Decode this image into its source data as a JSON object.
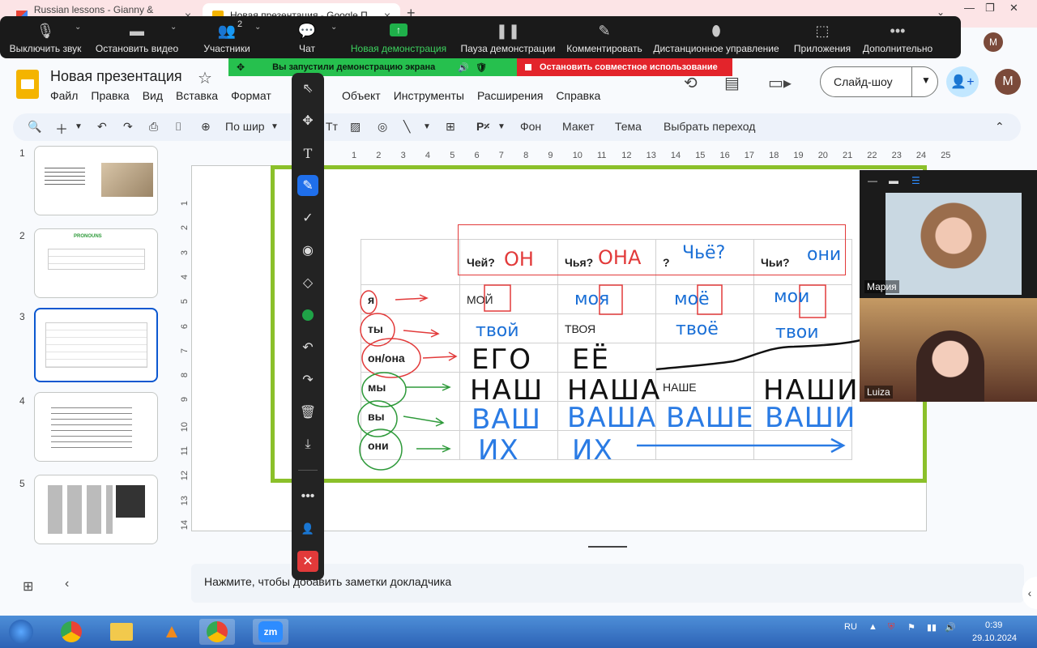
{
  "browser": {
    "tabs": [
      {
        "title": "Russian lessons - Gianny & Luiza",
        "favicon": "gmail-icon"
      },
      {
        "title": "Новая презентация - Google П",
        "favicon": "slides-icon"
      }
    ],
    "new_tab": "+",
    "profile_initial": "M"
  },
  "zoom": {
    "buttons": [
      {
        "label": "Выключить звук",
        "icon": "microphone-icon"
      },
      {
        "label": "Остановить видео",
        "icon": "camera-icon"
      },
      {
        "label": "Участники",
        "icon": "participants-icon",
        "count": "2"
      },
      {
        "label": "Чат",
        "icon": "chat-icon"
      },
      {
        "label": "Новая демонстрация",
        "icon": "share-screen-icon"
      },
      {
        "label": "Пауза демонстрации",
        "icon": "pause-icon"
      },
      {
        "label": "Комментировать",
        "icon": "pencil-icon"
      },
      {
        "label": "Дистанционное управление",
        "icon": "mouse-icon"
      },
      {
        "label": "Приложения",
        "icon": "apps-icon"
      },
      {
        "label": "Дополнительно",
        "icon": "more-icon"
      }
    ],
    "share_banner": "Вы запустили демонстрацию экрана",
    "stop_share": "Остановить совместное использование",
    "video_participants": [
      {
        "name": "Мария"
      },
      {
        "name": "Luiza"
      }
    ]
  },
  "slides": {
    "title": "Новая презентация",
    "menu": [
      "Файл",
      "Правка",
      "Вид",
      "Вставка",
      "Формат",
      "Объект",
      "Инструменты",
      "Расширения",
      "Справка"
    ],
    "slideshow_label": "Слайд-шоу",
    "avatar_initial": "M",
    "toolbar": {
      "zoom_label": "По шир",
      "background": "Фон",
      "layout": "Макет",
      "theme": "Тема",
      "transition": "Выбрать переход"
    },
    "thumbnails": [
      {
        "num": "1"
      },
      {
        "num": "2",
        "title": "PRONOUNS"
      },
      {
        "num": "3"
      },
      {
        "num": "4"
      },
      {
        "num": "5"
      }
    ],
    "ruler_top": [
      "1",
      "2",
      "3",
      "4",
      "5",
      "6",
      "7",
      "8",
      "9",
      "10",
      "11",
      "12",
      "13",
      "14",
      "15",
      "16",
      "17",
      "18",
      "19",
      "20",
      "21",
      "22",
      "23",
      "24",
      "25"
    ],
    "ruler_left": [
      "1",
      "2",
      "3",
      "4",
      "5",
      "6",
      "7",
      "8",
      "9",
      "10",
      "11",
      "12",
      "13",
      "14"
    ],
    "notes_placeholder": "Нажмите, чтобы добавить заметки докладчика"
  },
  "pronoun_table": {
    "headers": [
      "",
      "Чей?",
      "Чья?",
      "?",
      "Чьи?"
    ],
    "rows": [
      {
        "pronoun": "я",
        "cells": [
          "МОЙ",
          "",
          "",
          ""
        ]
      },
      {
        "pronoun": "ты",
        "cells": [
          "",
          "ТВОЯ",
          "",
          ""
        ]
      },
      {
        "pronoun": "он/она",
        "cells": [
          "",
          "",
          "",
          ""
        ]
      },
      {
        "pronoun": "мы",
        "cells": [
          "",
          "",
          "НАШЕ",
          ""
        ]
      },
      {
        "pronoun": "вы",
        "cells": [
          "",
          "",
          "",
          ""
        ]
      },
      {
        "pronoun": "они",
        "cells": [
          "",
          "",
          "",
          ""
        ]
      }
    ],
    "handwriting": {
      "header_on": "ОН",
      "header_ona": "ОНА",
      "header_chyo": "Чьё?",
      "header_oni": "они",
      "moya": "моя",
      "moyo": "моё",
      "moi": "мои",
      "tvoy": "твой",
      "tvoyo": "твоё",
      "tvoi": "твои",
      "ego": "ЕГО",
      "eyo": "ЕЁ",
      "nash": "НАШ",
      "nasha": "НАША",
      "nashi": "НАШИ",
      "vash": "ВАШ",
      "vasha": "ВАША",
      "vashe": "ВАШЕ",
      "vashi": "ВАШИ",
      "ikh1": "ИХ",
      "ikh2": "ИХ"
    }
  },
  "taskbar": {
    "lang": "RU",
    "time": "0:39",
    "date": "29.10.2024"
  },
  "colors": {
    "slide_border": "#8bc02a",
    "share_green": "#26c04e",
    "stop_red": "#e23a3a",
    "ink_blue": "#1a6fd6",
    "ink_red": "#e23a3a",
    "ink_green": "#2e9a3a"
  }
}
